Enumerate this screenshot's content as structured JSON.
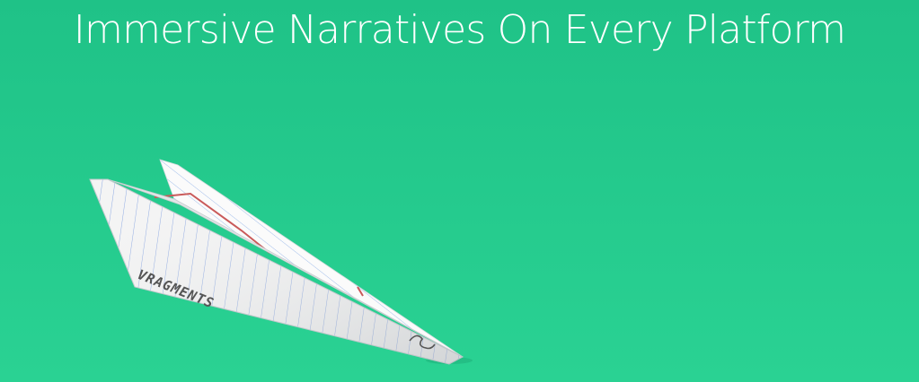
{
  "hero": {
    "title": "Immersive Narratives On Every Platform"
  },
  "illustration": {
    "name": "paper-airplane",
    "brand_mark": "VRAGMENTS"
  },
  "colors": {
    "background_top": "#1fc287",
    "background_bottom": "#2ad293",
    "title_text": "#ffffff",
    "paper": "#f4f4f4",
    "paper_shadow": "#cfd3d6",
    "rule_line": "#7e9ee0",
    "margin_line": "#c95a5a",
    "ink": "#555555"
  }
}
